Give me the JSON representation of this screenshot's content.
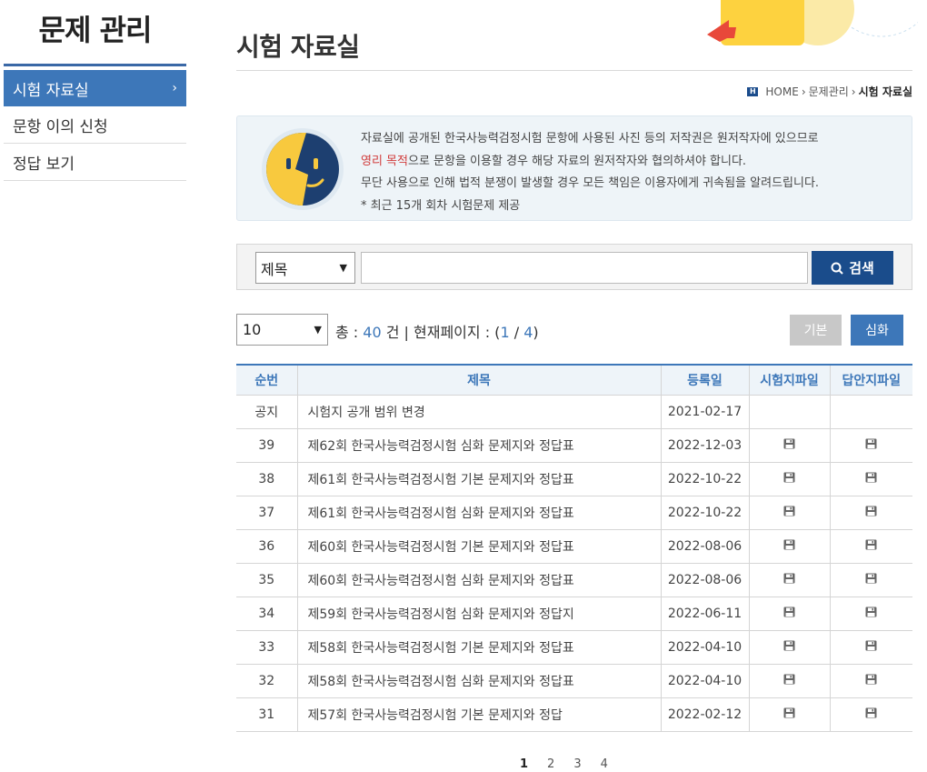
{
  "sidebar": {
    "title": "문제 관리",
    "items": [
      {
        "label": "시험 자료실"
      },
      {
        "label": "문항 이의 신청"
      },
      {
        "label": "정답 보기"
      }
    ]
  },
  "header": {
    "title": "시험 자료실",
    "breadcrumb": {
      "home": "HOME",
      "section": "문제관리",
      "current": "시험 자료실"
    }
  },
  "notice": {
    "line1": "자료실에 공개된 한국사능력검정시험 문항에 사용된 사진 등의 저작권은 원저작자에 있으므로",
    "line2_highlight": "영리 목적",
    "line2_rest": "으로 문항을 이용할 경우 해당 자료의 원저작자와 협의하셔야 합니다.",
    "line3": "무단 사용으로 인해 법적 분쟁이 발생할 경우 모든 책임은 이용자에게 귀속됨을 알려드립니다.",
    "line4": "* 최근 15개 회차 시험문제 제공"
  },
  "search": {
    "field_value": "제목",
    "query": "",
    "button_label": "검색"
  },
  "list_controls": {
    "per_page": "10",
    "total_label": "총 : ",
    "total": "40",
    "unit_label": " 건 | 현재페이지 : (",
    "current_page": "1",
    "page_sep": " / ",
    "total_pages": "4",
    "page_close": ")",
    "basic_label": "기본",
    "advanced_label": "심화"
  },
  "table": {
    "headers": [
      "순번",
      "제목",
      "등록일",
      "시험지파일",
      "답안지파일"
    ],
    "rows": [
      {
        "no": "공지",
        "title": "시험지 공개 범위 변경",
        "date": "2021-02-17",
        "exam_file": false,
        "answer_file": false
      },
      {
        "no": "39",
        "title": "제62회 한국사능력검정시험 심화 문제지와 정답표",
        "date": "2022-12-03",
        "exam_file": true,
        "answer_file": true
      },
      {
        "no": "38",
        "title": "제61회 한국사능력검정시험 기본 문제지와 정답표",
        "date": "2022-10-22",
        "exam_file": true,
        "answer_file": true
      },
      {
        "no": "37",
        "title": "제61회 한국사능력검정시험 심화 문제지와 정답표",
        "date": "2022-10-22",
        "exam_file": true,
        "answer_file": true
      },
      {
        "no": "36",
        "title": "제60회 한국사능력검정시험 기본 문제지와 정답표",
        "date": "2022-08-06",
        "exam_file": true,
        "answer_file": true
      },
      {
        "no": "35",
        "title": "제60회 한국사능력검정시험 심화 문제지와 정답표",
        "date": "2022-08-06",
        "exam_file": true,
        "answer_file": true
      },
      {
        "no": "34",
        "title": "제59회 한국사능력검정시험 심화 문제지와 정답지",
        "date": "2022-06-11",
        "exam_file": true,
        "answer_file": true
      },
      {
        "no": "33",
        "title": "제58회 한국사능력검정시험 기본 문제지와 정답표",
        "date": "2022-04-10",
        "exam_file": true,
        "answer_file": true
      },
      {
        "no": "32",
        "title": "제58회 한국사능력검정시험 심화 문제지와 정답표",
        "date": "2022-04-10",
        "exam_file": true,
        "answer_file": true
      },
      {
        "no": "31",
        "title": "제57회 한국사능력검정시험 기본 문제지와 정답",
        "date": "2022-02-12",
        "exam_file": true,
        "answer_file": true
      }
    ]
  },
  "pagination": {
    "pages": [
      "1",
      "2",
      "3",
      "4"
    ],
    "current": "1"
  },
  "icons": {
    "file": "save-disk-icon",
    "search": "magnifier-icon",
    "chevron": "chevron-right-icon"
  },
  "colors": {
    "accent": "#3d77b9",
    "dark_accent": "#1a4c8b",
    "highlight": "#d13c3c"
  }
}
